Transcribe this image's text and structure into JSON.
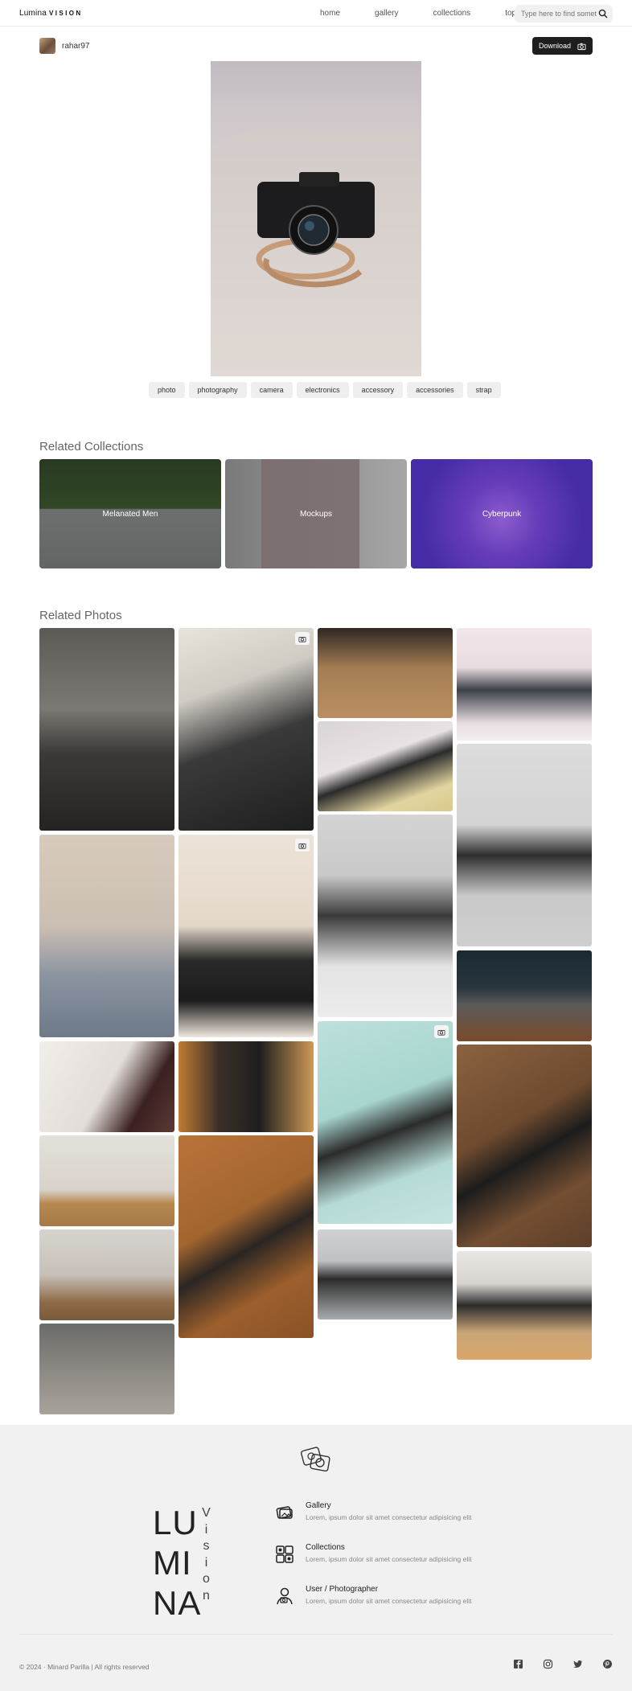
{
  "nav": {
    "brand_part1": "Lumina",
    "brand_part2": "VISION",
    "links": [
      "home",
      "gallery",
      "collections",
      "topics"
    ],
    "search_placeholder": "Type here to find something"
  },
  "user": {
    "name": "rahar97"
  },
  "download_label": "Download",
  "tags": [
    "photo",
    "photography",
    "camera",
    "electronics",
    "accessory",
    "accessories",
    "strap"
  ],
  "related_collections": {
    "title": "Related Collections",
    "items": [
      {
        "label": "Melanated Men"
      },
      {
        "label": "Mockups"
      },
      {
        "label": "Cyberpunk"
      }
    ]
  },
  "related_photos": {
    "title": "Related Photos"
  },
  "footer": {
    "big_letters": [
      "LU",
      "MI",
      "NA"
    ],
    "vision_letters": [
      "V",
      "i",
      "s",
      "i",
      "o",
      "n"
    ],
    "features": [
      {
        "title": "Gallery",
        "desc": "Lorem, ipsum dolor sit amet consectetur adipisicing elit"
      },
      {
        "title": "Collections",
        "desc": "Lorem, ipsum dolor sit amet consectetur adipisicing elit"
      },
      {
        "title": "User / Photographer",
        "desc": "Lorem, ipsum dolor sit amet consectetur adipisicing elit"
      }
    ],
    "copyright": "© 2024 · Minard Parilla | All rights reserved",
    "socials": [
      "facebook-icon",
      "instagram-icon",
      "twitter-icon",
      "pinterest-icon"
    ]
  },
  "colors": {
    "download_bg": "#1e1e1e",
    "tag_bg": "#efefef",
    "footer_bg": "#f1f1f1",
    "cyberpunk": "#4a2fb0"
  }
}
